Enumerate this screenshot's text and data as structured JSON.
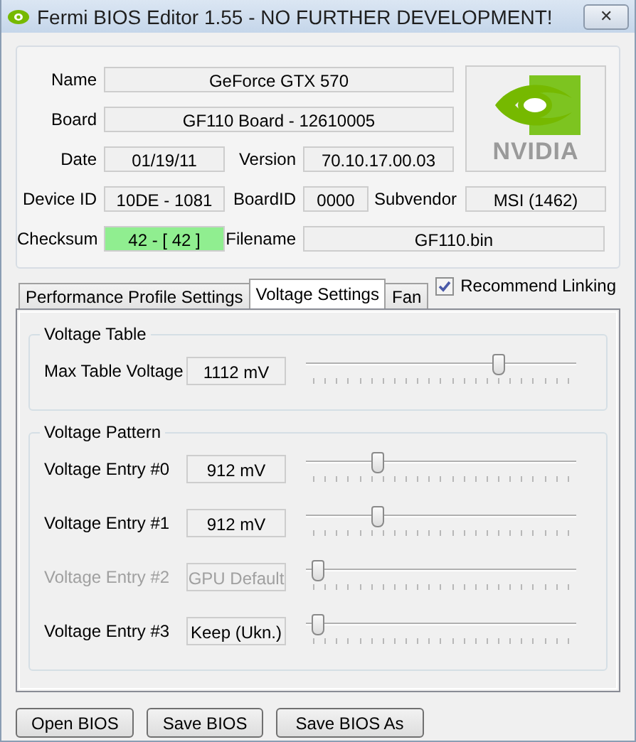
{
  "window": {
    "title": "Fermi BIOS Editor 1.55 - NO FURTHER DEVELOPMENT!",
    "close": "✕"
  },
  "info": {
    "name_label": "Name",
    "name": "GeForce GTX 570",
    "board_label": "Board",
    "board": "GF110 Board - 12610005",
    "date_label": "Date",
    "date": "01/19/11",
    "version_label": "Version",
    "version": "70.10.17.00.03",
    "device_label": "Device ID",
    "device": "10DE - 1081",
    "boardid_label": "BoardID",
    "boardid": "0000",
    "subvendor_label": "Subvendor",
    "subvendor": "MSI (1462)",
    "checksum_label": "Checksum",
    "checksum": "42 - [ 42 ]",
    "checksum_ok": true,
    "filename_label": "Filename",
    "filename": "GF110.bin",
    "logo_text": "NVIDIA"
  },
  "tabs": [
    {
      "label": "Performance Profile Settings",
      "selected": false
    },
    {
      "label": "Voltage Settings",
      "selected": true
    },
    {
      "label": "Fan",
      "selected": false
    }
  ],
  "recommend_linking": {
    "label": "Recommend Linking",
    "checked": true
  },
  "voltage_table": {
    "title": "Voltage Table",
    "rows": [
      {
        "label": "Max Table Voltage",
        "value": "1112 mV",
        "level": 0.74,
        "disabled": false
      }
    ]
  },
  "voltage_pattern": {
    "title": "Voltage Pattern",
    "rows": [
      {
        "label": "Voltage Entry #0",
        "value": "912 mV",
        "level": 0.26,
        "disabled": false
      },
      {
        "label": "Voltage Entry #1",
        "value": "912 mV",
        "level": 0.26,
        "disabled": false
      },
      {
        "label": "Voltage Entry #2",
        "value": "GPU Default",
        "level": 0.02,
        "disabled": true
      },
      {
        "label": "Voltage Entry #3",
        "value": "Keep (Ukn.)",
        "level": 0.02,
        "disabled": false
      }
    ]
  },
  "buttons": [
    "Open BIOS",
    "Save BIOS",
    "Save BIOS As"
  ]
}
